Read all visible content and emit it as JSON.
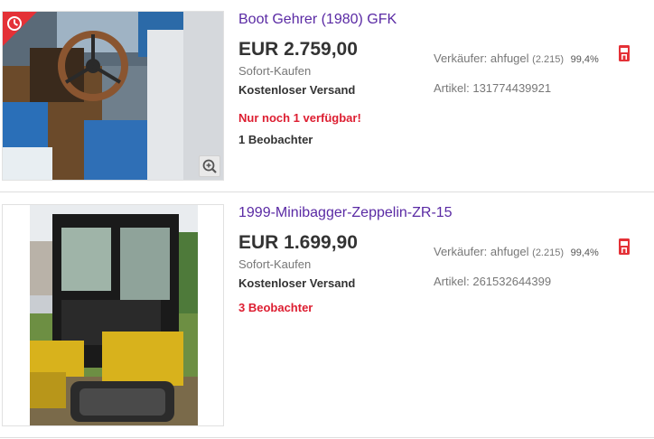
{
  "listings": [
    {
      "title": "Boot Gehrer (1980) GFK",
      "price": "EUR 2.759,00",
      "format": "Sofort-Kaufen",
      "shipping": "Kostenloser Versand",
      "availability": "Nur noch 1 verfügbar!",
      "watchers": "1 Beobachter",
      "seller_label": "Verkäufer: ahfugel",
      "seller_count": "(2.215)",
      "seller_pct": "99,4%",
      "item_number": "Artikel: 131774439921"
    },
    {
      "title": "1999-Minibagger-Zeppelin-ZR-15",
      "price": "EUR 1.699,90",
      "format": "Sofort-Kaufen",
      "shipping": "Kostenloser Versand",
      "watchers": "3 Beobachter",
      "seller_label": "Verkäufer: ahfugel",
      "seller_count": "(2.215)",
      "seller_pct": "99,4%",
      "item_number": "Artikel: 261532644399"
    }
  ],
  "icons": {
    "time_badge": "clock-icon",
    "zoom": "zoom-in-icon",
    "shop": "shop-icon"
  },
  "colors": {
    "title_link": "#5a2aa4",
    "alert_red": "#dd1e31",
    "badge_red": "#e43137"
  }
}
